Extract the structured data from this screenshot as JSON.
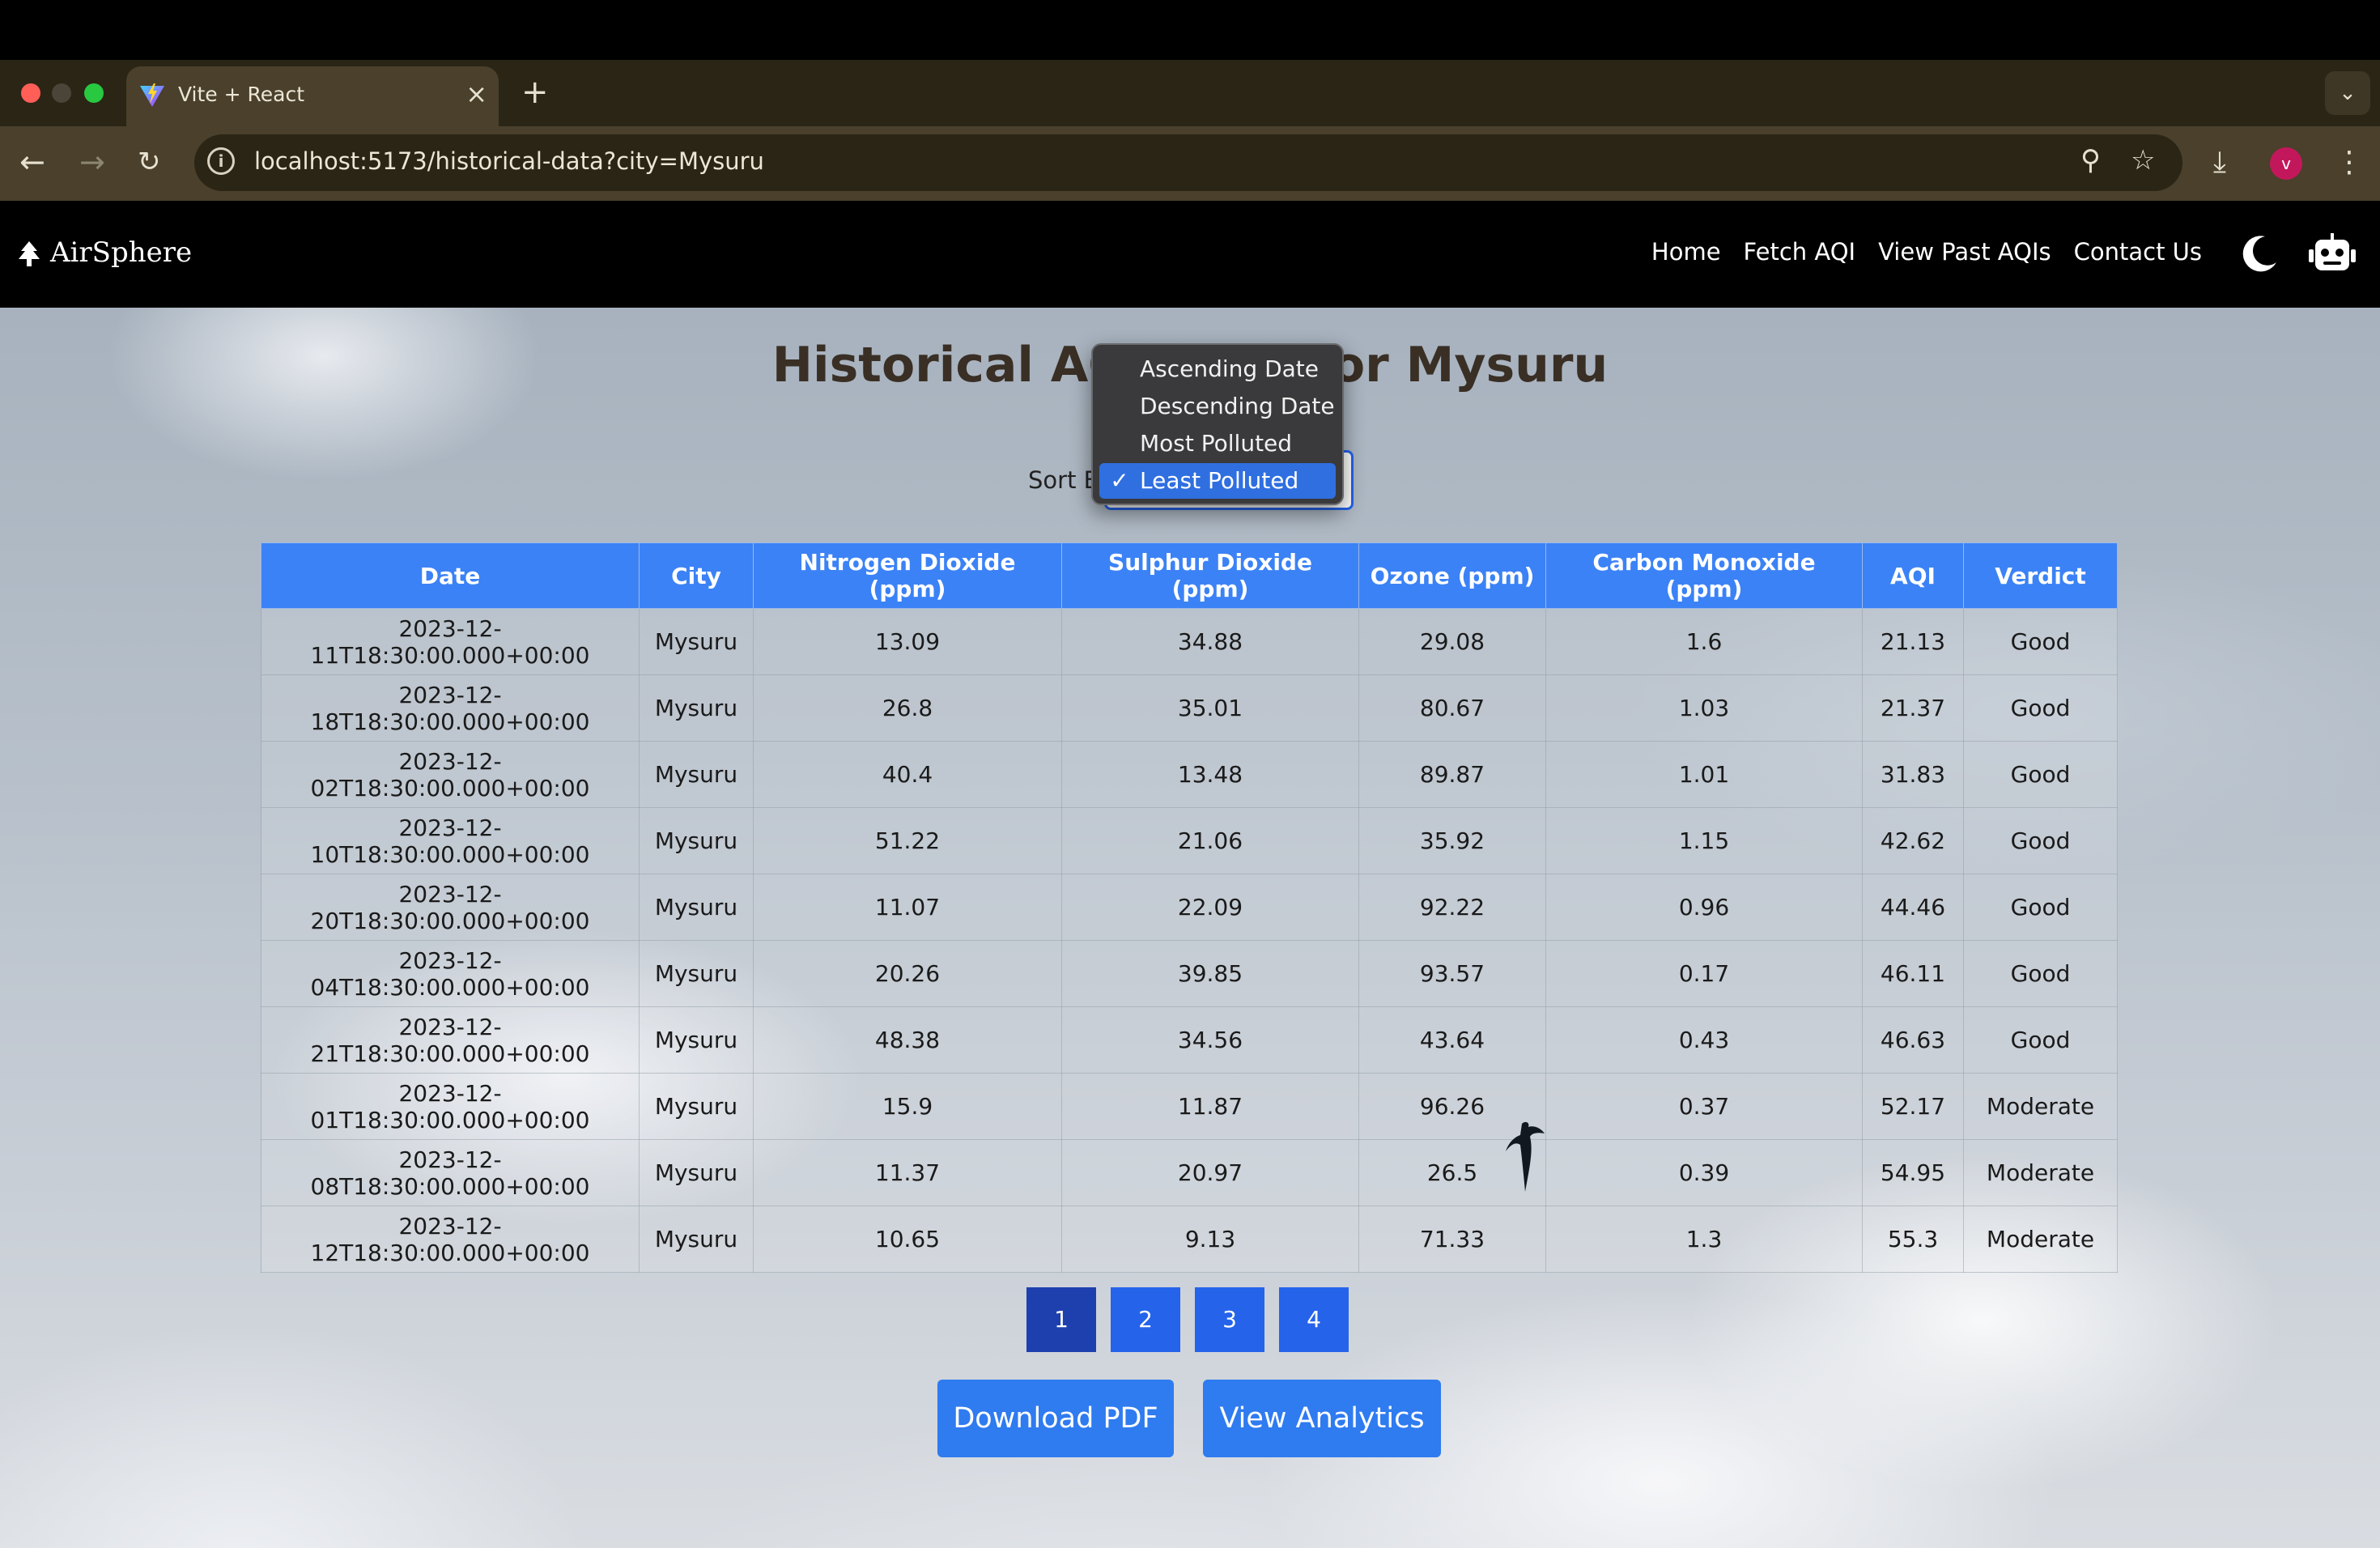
{
  "browser": {
    "tab_title": "Vite + React",
    "tab_close": "×",
    "new_tab": "+",
    "url": "localhost:5173/historical-data?city=Mysuru",
    "profile_initial": "v"
  },
  "app": {
    "brand": "AirSphere",
    "nav": [
      "Home",
      "Fetch AQI",
      "View Past AQIs",
      "Contact Us"
    ]
  },
  "page": {
    "title": "Historical AQI Data for Mysuru",
    "sort_label": "Sort By:",
    "sort_options": [
      "Ascending Date",
      "Descending Date",
      "Most Polluted",
      "Least Polluted"
    ],
    "sort_selected": "Least Polluted",
    "check": "✓"
  },
  "table": {
    "headers": [
      "Date",
      "City",
      "Nitrogen Dioxide (ppm)",
      "Sulphur Dioxide (ppm)",
      "Ozone (ppm)",
      "Carbon Monoxide (ppm)",
      "AQI",
      "Verdict"
    ],
    "rows": [
      [
        "2023-12-11T18:30:00.000+00:00",
        "Mysuru",
        "13.09",
        "34.88",
        "29.08",
        "1.6",
        "21.13",
        "Good"
      ],
      [
        "2023-12-18T18:30:00.000+00:00",
        "Mysuru",
        "26.8",
        "35.01",
        "80.67",
        "1.03",
        "21.37",
        "Good"
      ],
      [
        "2023-12-02T18:30:00.000+00:00",
        "Mysuru",
        "40.4",
        "13.48",
        "89.87",
        "1.01",
        "31.83",
        "Good"
      ],
      [
        "2023-12-10T18:30:00.000+00:00",
        "Mysuru",
        "51.22",
        "21.06",
        "35.92",
        "1.15",
        "42.62",
        "Good"
      ],
      [
        "2023-12-20T18:30:00.000+00:00",
        "Mysuru",
        "11.07",
        "22.09",
        "92.22",
        "0.96",
        "44.46",
        "Good"
      ],
      [
        "2023-12-04T18:30:00.000+00:00",
        "Mysuru",
        "20.26",
        "39.85",
        "93.57",
        "0.17",
        "46.11",
        "Good"
      ],
      [
        "2023-12-21T18:30:00.000+00:00",
        "Mysuru",
        "48.38",
        "34.56",
        "43.64",
        "0.43",
        "46.63",
        "Good"
      ],
      [
        "2023-12-01T18:30:00.000+00:00",
        "Mysuru",
        "15.9",
        "11.87",
        "96.26",
        "0.37",
        "52.17",
        "Moderate"
      ],
      [
        "2023-12-08T18:30:00.000+00:00",
        "Mysuru",
        "11.37",
        "20.97",
        "26.5",
        "0.39",
        "54.95",
        "Moderate"
      ],
      [
        "2023-12-12T18:30:00.000+00:00",
        "Mysuru",
        "10.65",
        "9.13",
        "71.33",
        "1.3",
        "55.3",
        "Moderate"
      ]
    ]
  },
  "pagination": {
    "pages": [
      "1",
      "2",
      "3",
      "4"
    ],
    "current": "1"
  },
  "actions": {
    "download_pdf": "Download PDF",
    "view_analytics": "View Analytics"
  },
  "icons": {
    "back": "back-arrow-icon",
    "forward": "forward-arrow-icon",
    "reload": "reload-icon",
    "zoom": "zoom-icon",
    "bookmark": "star-icon",
    "download": "download-icon",
    "menu": "kebab-menu-icon",
    "theme": "moon-icon",
    "chatbot": "robot-icon",
    "brand": "tree-icon"
  },
  "colors": {
    "header_blue": "#3b82f6",
    "button_blue": "#2563eb",
    "active_page": "#1e40af"
  }
}
